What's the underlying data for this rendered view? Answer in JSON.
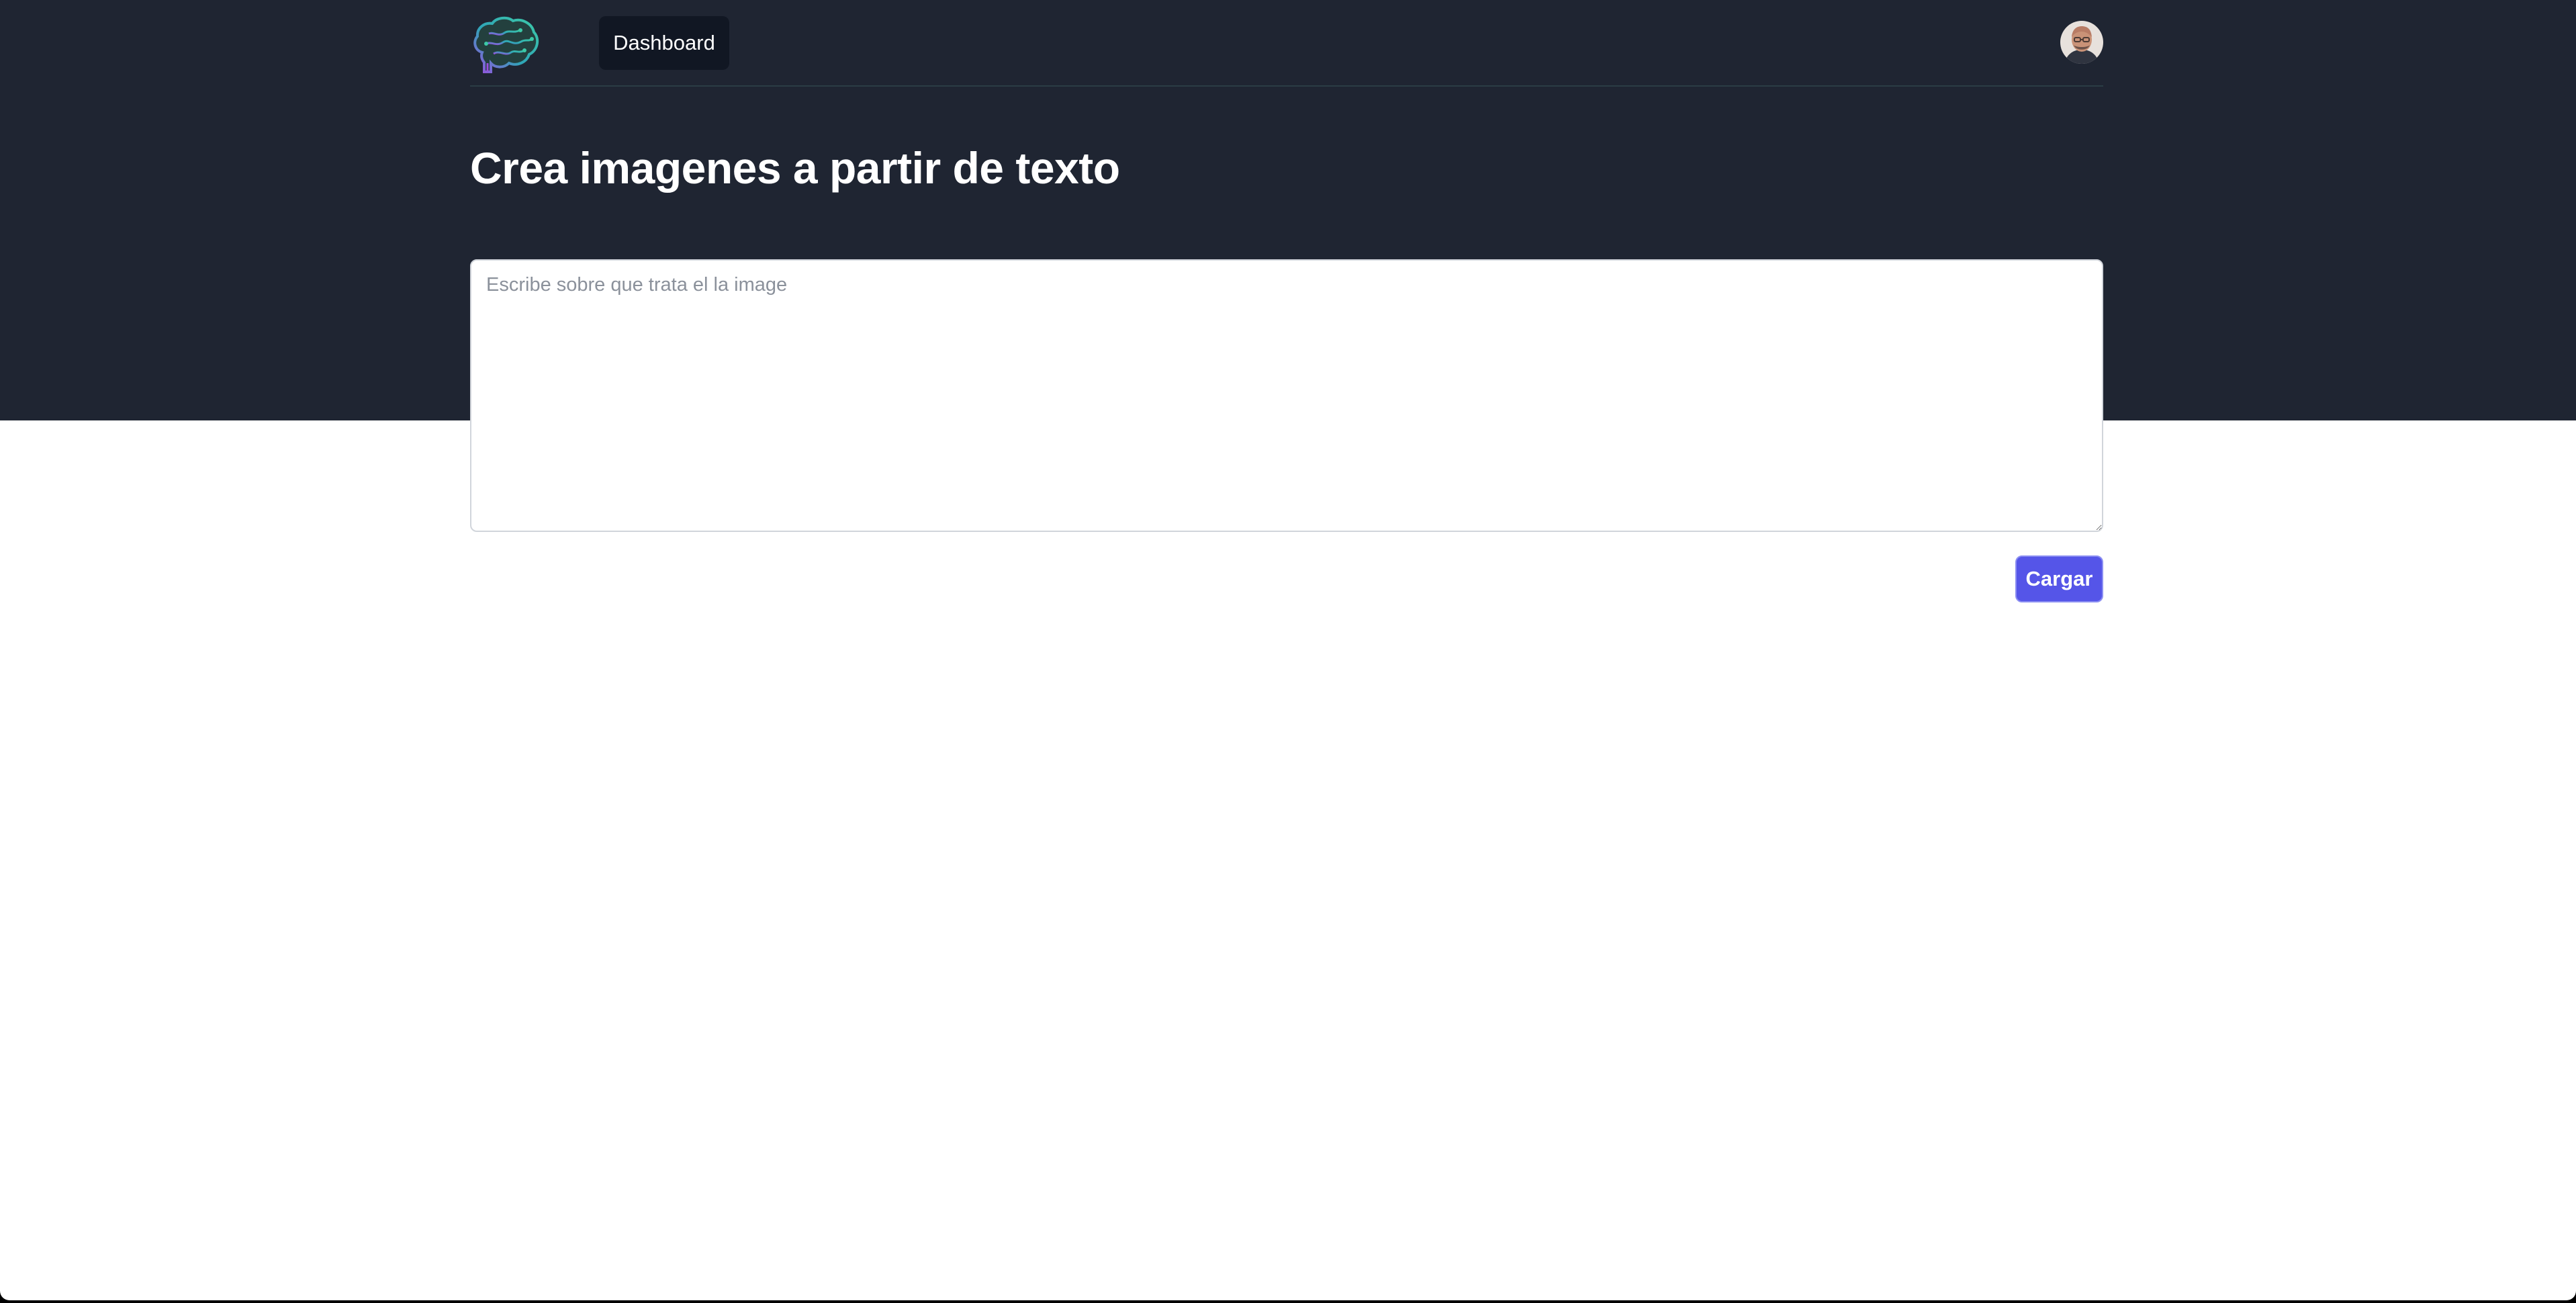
{
  "nav": {
    "logo_icon": "brain-circuit-logo-icon",
    "items": [
      {
        "label": "Dashboard"
      }
    ],
    "avatar_icon": "user-avatar-icon"
  },
  "main": {
    "title": "Crea imagenes a partir de texto",
    "prompt": {
      "value": "",
      "placeholder": "Escribe sobre que trata el la image"
    },
    "submit_label": "Cargar"
  },
  "colors": {
    "header_background": "#1f2532",
    "nav_item_background": "#111723",
    "button_background": "#5555e8",
    "page_background": "#ffffff"
  }
}
